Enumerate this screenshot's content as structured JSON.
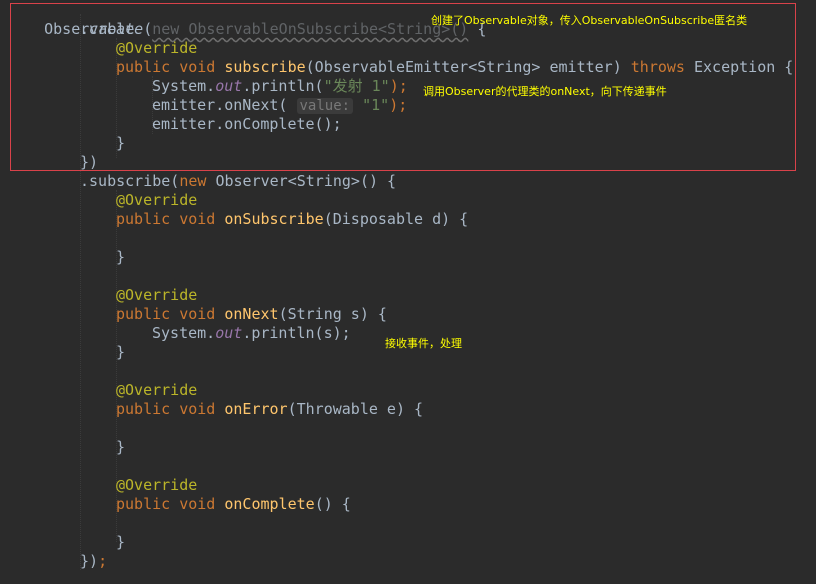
{
  "annotations": {
    "note1": "创建了Observable对象，传入ObservableOnSubscribe匿名类",
    "note2": "调用Observer的代理类的onNext，向下传递事件",
    "note3": "接收事件，处理"
  },
  "code": {
    "l1_class": "Observable",
    "l2_dot": ".",
    "l2_create": "create",
    "l2_paren": "(",
    "l2_new": "new ObservableOnSubscribe<String>()",
    "l2_brace": " {",
    "l3_ann": "@Override",
    "l4_public": "public",
    "l4_void": "void",
    "l4_name": "subscribe",
    "l4_params": "(ObservableEmitter<String> emitter) ",
    "l4_throws": "throws",
    "l4_rest": " Exception {",
    "l5_sys": "System.",
    "l5_out": "out",
    "l5_println": ".println(",
    "l5_str": "\"发射 1\"",
    "l5_end": ");",
    "l6_call": "emitter.onNext( ",
    "l6_hint": "value:",
    "l6_str": "\"1\"",
    "l6_end": ");",
    "l7_call": "emitter.onComplete();",
    "l8_close": "}",
    "l9_close": "})",
    "l10_subscribe": ".subscribe(",
    "l10_new": "new",
    "l10_rest": " Observer<String>() {",
    "l11_ann": "@Override",
    "l12_public": "public",
    "l12_void": "void",
    "l12_name": "onSubscribe",
    "l12_rest": "(Disposable d) {",
    "l13_close": "}",
    "l14_ann": "@Override",
    "l15_public": "public",
    "l15_void": "void",
    "l15_name": "onNext",
    "l15_rest": "(String s) {",
    "l16_sys": "System.",
    "l16_out": "out",
    "l16_println": ".println(s);",
    "l17_close": "}",
    "l18_ann": "@Override",
    "l19_public": "public",
    "l19_void": "void",
    "l19_name": "onError",
    "l19_rest": "(Throwable e) {",
    "l20_close": "}",
    "l21_ann": "@Override",
    "l22_public": "public",
    "l22_void": "void",
    "l22_name": "onComplete",
    "l22_rest": "() {",
    "l23_close": "}",
    "l24_close": "})",
    "l24_semi": ";"
  },
  "colors": {
    "background": "#2b2b2b",
    "keyword": "#cc7832",
    "annotation": "#bbb529",
    "method": "#ffc66d",
    "field": "#9876aa",
    "string": "#6a8759",
    "note_text": "#ffff00",
    "highlight_border": "#d9424a"
  }
}
